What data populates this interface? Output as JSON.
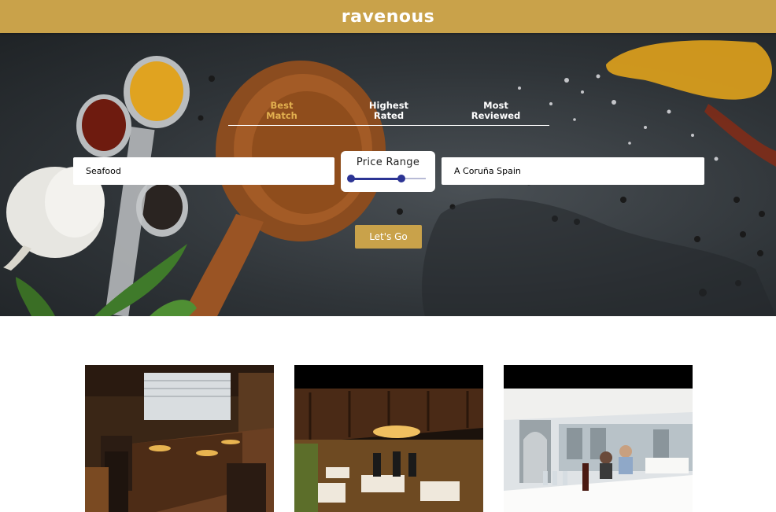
{
  "header": {
    "logo": "ravenous"
  },
  "sort_tabs": [
    {
      "label_line1": "Best",
      "label_line2": "Match",
      "active": true
    },
    {
      "label_line1": "Highest",
      "label_line2": "Rated",
      "active": false
    },
    {
      "label_line1": "Most",
      "label_line2": "Reviewed",
      "active": false
    }
  ],
  "search": {
    "term_value": "Seafood",
    "location_value": "A Coruña Spain",
    "price_label": "Price Range",
    "price_range_selected_fraction": [
      0.0,
      0.67
    ],
    "submit_label": "Let's Go"
  },
  "colors": {
    "brand_gold": "#c9a24a",
    "active_tab": "#e2b04f",
    "slider": "#2c3494"
  },
  "results": [
    {
      "image": "restaurant-interior-wood-tables"
    },
    {
      "image": "restaurant-interior-dark-dining-hall"
    },
    {
      "image": "restaurant-terrace-white-tablecloth"
    }
  ]
}
